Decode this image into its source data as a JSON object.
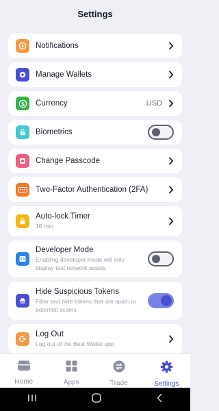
{
  "header": {
    "title": "Settings"
  },
  "items": [
    {
      "label": "Notifications",
      "icon": "bell-icon",
      "icon_color": "#f29a46"
    },
    {
      "label": "Manage Wallets",
      "icon": "wallet-icon",
      "icon_color": "#4a4fd1"
    },
    {
      "label": "Currency",
      "value": "USD",
      "icon": "dollar-icon",
      "icon_color": "#31b24a"
    },
    {
      "label": "Biometrics",
      "icon": "lock-icon",
      "icon_color": "#47c7cf",
      "toggle": "off"
    },
    {
      "label": "Change Passcode",
      "icon": "passcode-icon",
      "icon_color": "#ec5d7f"
    },
    {
      "label": "Two-Factor Authentication (2FA)",
      "icon": "dots-icon",
      "icon_color": "#f07a2e"
    },
    {
      "label": "Auto-lock Timer",
      "sublabel": "10 min",
      "icon": "clock-icon",
      "icon_color": "#f4b619"
    },
    {
      "label": "Developer Mode",
      "sublabel": "Enabling developer mode will only display test network assets",
      "icon": "code-icon",
      "icon_color": "#2e83e6",
      "toggle": "off"
    },
    {
      "label": "Hide Suspicious Tokens",
      "sublabel": "Filter and hide tokens that are spam or potential scams",
      "icon": "spy-icon",
      "icon_color": "#4a4fd1",
      "toggle": "on"
    },
    {
      "label": "Log Out",
      "sublabel": "Log out of the Best Wallet app",
      "icon": "logout-icon",
      "icon_color": "#f29a46"
    }
  ],
  "tabs": [
    {
      "label": "Home",
      "icon": "home-icon",
      "active": false
    },
    {
      "label": "Apps",
      "icon": "apps-icon",
      "active": false
    },
    {
      "label": "Trade",
      "icon": "trade-icon",
      "active": false
    },
    {
      "label": "Settings",
      "icon": "gear-icon",
      "active": true
    }
  ],
  "colors": {
    "accent": "#4b4fcf",
    "background": "#eef0f6",
    "toggle_on": "#7a82e6"
  }
}
